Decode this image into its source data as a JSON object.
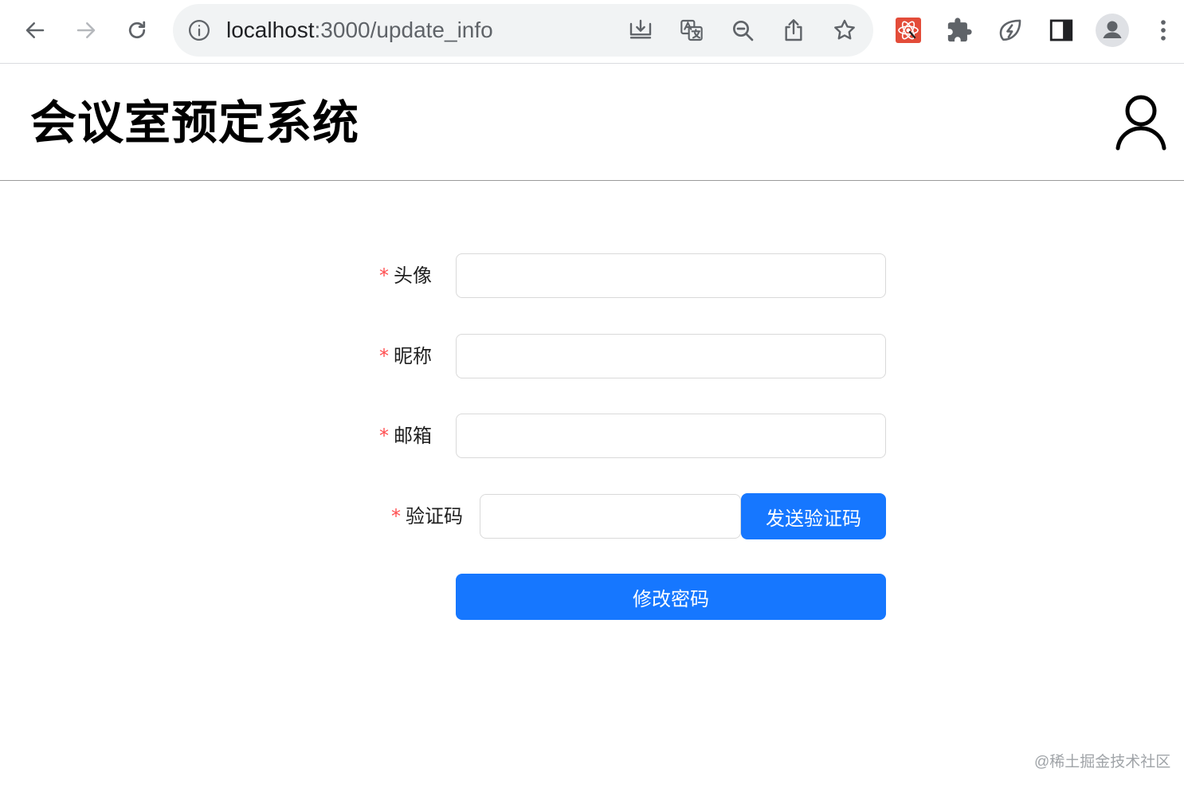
{
  "browser": {
    "url_host": "localhost",
    "url_path": ":3000/update_info",
    "nav": {
      "back_icon": "arrow-left-icon",
      "forward_icon": "arrow-right-icon",
      "reload_icon": "reload-icon"
    },
    "omnibox_icons": [
      "install-icon",
      "translate-icon",
      "zoom-out-icon",
      "share-icon",
      "bookmark-star-icon"
    ],
    "toolbar_icons": [
      "react-devtools-icon",
      "extensions-puzzle-icon",
      "leaf-bolt-icon",
      "side-panel-icon",
      "profile-avatar-icon",
      "menu-kebab-icon"
    ]
  },
  "header": {
    "title": "会议室预定系统",
    "user_icon": "user-outline-icon"
  },
  "form": {
    "required_mark": "*",
    "fields": [
      {
        "label": "头像",
        "value": ""
      },
      {
        "label": "昵称",
        "value": ""
      },
      {
        "label": "邮箱",
        "value": ""
      }
    ],
    "captcha": {
      "label": "验证码",
      "value": "",
      "send_button": "发送验证码"
    },
    "submit_button": "修改密码"
  },
  "watermark": "@稀土掘金技术社区",
  "colors": {
    "primary": "#1677ff",
    "required": "#ff4d4f",
    "react_devtools_bg": "#e34c39"
  }
}
